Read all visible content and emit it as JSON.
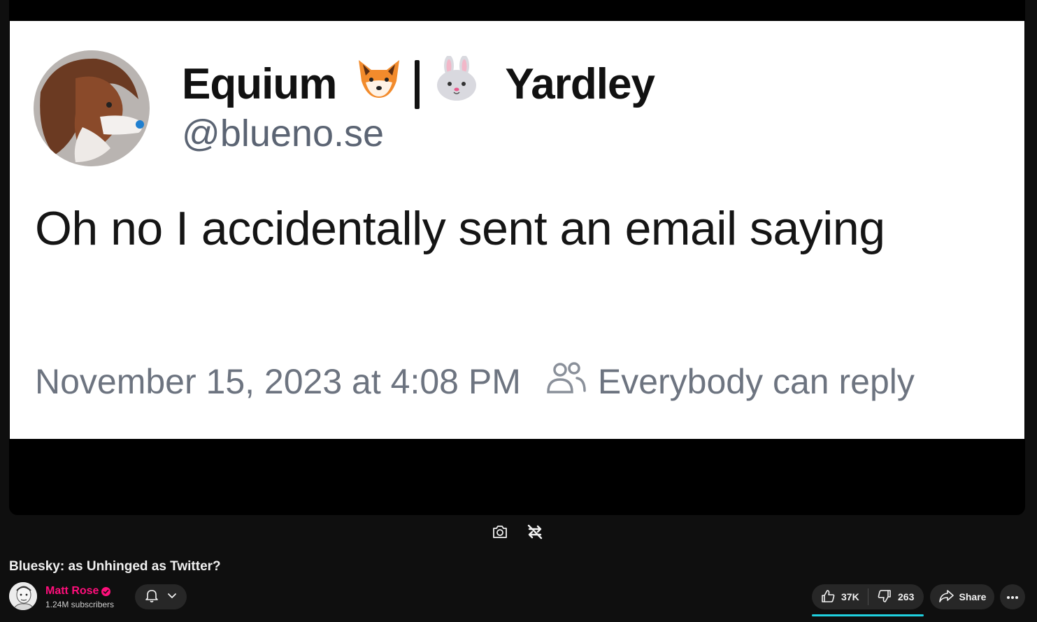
{
  "tweet": {
    "display_name_first": "Equium",
    "display_name_second": "Yardley",
    "emoji_1": "fox-face-emoji",
    "emoji_2": "rabbit-face-emoji",
    "handle": "@blueno.se",
    "text": "Oh no I accidentally sent an email saying",
    "timestamp": "November 15, 2023 at 4:08 PM",
    "reply_setting": "Everybody can reply"
  },
  "player": {
    "screenshot_icon": "camera-icon",
    "loop_icon": "loop-off-icon"
  },
  "video": {
    "title": "Bluesky: as Unhinged as Twitter?"
  },
  "channel": {
    "name": "Matt Rose",
    "subscribers": "1.24M subscribers",
    "name_color": "#ff0f7b"
  },
  "actions": {
    "likes": "37K",
    "dislikes": "263",
    "share_label": "Share"
  },
  "colors": {
    "background": "#0f0f0f",
    "button_bg": "#272727",
    "like_underline": "#1fd1e0"
  }
}
